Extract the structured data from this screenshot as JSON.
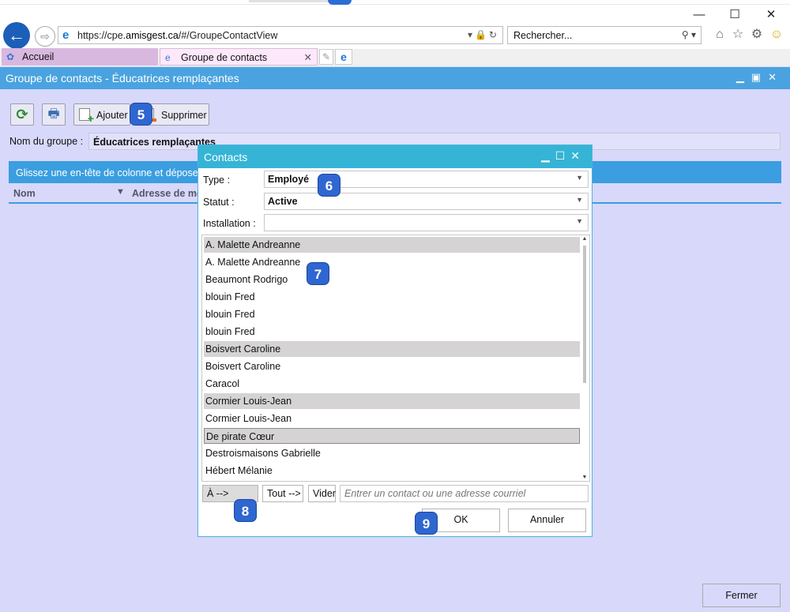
{
  "browser": {
    "url_prefix": "https://cpe.",
    "url_domain": "amisgest.ca",
    "url_path": "/#/GroupeContactView",
    "search_placeholder": "Rechercher...",
    "tabs": [
      {
        "label": "Accueil"
      },
      {
        "label": "Groupe de contacts"
      }
    ],
    "window_controls": {
      "minimize": "—",
      "maximize": "☐",
      "close": "✕"
    }
  },
  "app": {
    "title": "Groupe de contacts - Éducatrices remplaçantes",
    "toolbar": {
      "add_label": "Ajouter",
      "delete_label": "Supprimer"
    },
    "group_name_label": "Nom du groupe :",
    "group_name_value": "Éducatrices remplaçantes",
    "group_bar_text": "Glissez une en-tête de colonne et déposez-",
    "columns": [
      "Nom",
      "Adresse de me"
    ],
    "close_label": "Fermer"
  },
  "dialog": {
    "title": "Contacts",
    "type_label": "Type :",
    "type_value": "Employé",
    "status_label": "Statut :",
    "status_value": "Active",
    "installation_label": "Installation :",
    "installation_value": "",
    "contacts": [
      {
        "name": "A. Malette  Andreanne",
        "state": "sel"
      },
      {
        "name": "A. Malette  Andreanne",
        "state": ""
      },
      {
        "name": "Beaumont  Rodrigo",
        "state": ""
      },
      {
        "name": "blouin  Fred",
        "state": ""
      },
      {
        "name": "blouin  Fred",
        "state": ""
      },
      {
        "name": "blouin  Fred",
        "state": ""
      },
      {
        "name": "Boisvert  Caroline",
        "state": "sel"
      },
      {
        "name": "Boisvert  Caroline",
        "state": ""
      },
      {
        "name": "Caracol",
        "state": ""
      },
      {
        "name": "Cormier  Louis-Jean",
        "state": "sel"
      },
      {
        "name": "Cormier  Louis-Jean",
        "state": ""
      },
      {
        "name": "De pirate  Cœur",
        "state": "focus"
      },
      {
        "name": "Destroismaisons  Gabrielle",
        "state": ""
      },
      {
        "name": "Hébert  Mélanie",
        "state": ""
      }
    ],
    "to_label": "À -->",
    "all_label": "Tout -->",
    "clear_label": "Vider",
    "contact_placeholder": "Entrer un contact ou une adresse courriel",
    "ok_label": "OK",
    "cancel_label": "Annuler"
  },
  "badges": [
    "5",
    "6",
    "7",
    "8",
    "9"
  ]
}
